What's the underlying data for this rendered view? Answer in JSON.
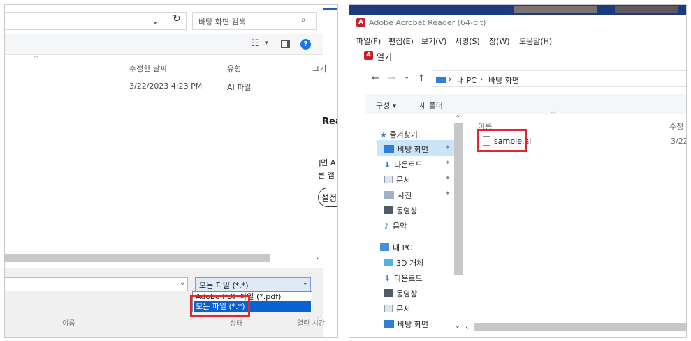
{
  "left": {
    "search_placeholder": "바탕 화면 검색",
    "columns": {
      "date": "수정한 날짜",
      "type": "유형",
      "size": "크기"
    },
    "file": {
      "date": "3/22/2023 4:23 PM",
      "type": "AI 파일"
    },
    "behind_text": {
      "title": "Rea",
      "line1": "]면 A",
      "line2": "른 앱",
      "button": "설정"
    },
    "filter_selected": "모든 파일 (*.*)",
    "filter_options": [
      "Adobe PDF 파일 (*.pdf)",
      "모든 파일 (*.*)"
    ],
    "footer": {
      "name": "이름",
      "status": "상태",
      "opened": "열린 시간"
    },
    "icons": [
      "chevron-down-icon",
      "refresh-icon",
      "search-icon",
      "view-options-icon",
      "preview-pane-icon",
      "help-icon",
      "chevron-right-icon"
    ]
  },
  "right": {
    "app_title": "Adobe Acrobat Reader (64-bit)",
    "menu": [
      "파일(F)",
      "편집(E)",
      "보기(V)",
      "서명(S)",
      "창(W)",
      "도움말(H)"
    ],
    "dialog_title": "열기",
    "breadcrumb": [
      "내 PC",
      "바탕 화면"
    ],
    "commands": {
      "organize": "구성 ▾",
      "new_folder": "새 폴더"
    },
    "nav": {
      "quick_access": "즐겨찾기",
      "items": [
        "바탕 화면",
        "다운로드",
        "문서",
        "사진",
        "동영상",
        "음악"
      ],
      "this_pc": "내 PC",
      "pc_items": [
        "3D 개체",
        "다운로드",
        "동영상",
        "문서",
        "바탕 화면"
      ]
    },
    "columns": {
      "name": "이름",
      "date": "수정"
    },
    "file": {
      "name": "sample.ai",
      "date": "3/22"
    },
    "colors": {
      "accent": "#0a62d0",
      "highlight": "#e32630",
      "acrobat": "#c92028"
    }
  }
}
